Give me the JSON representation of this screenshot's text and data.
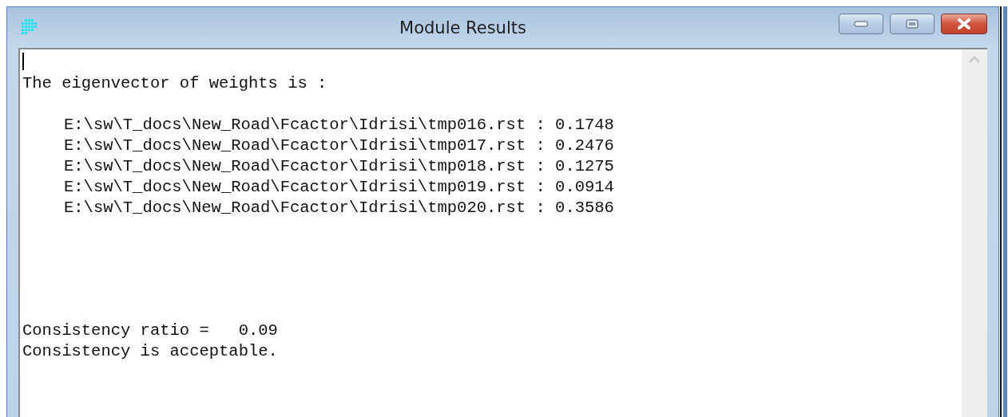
{
  "window": {
    "title": "Module Results"
  },
  "output": {
    "heading": "The eigenvector of weights is :",
    "weights": [
      "E:\\sw\\T_docs\\New_Road\\Fcactor\\Idrisi\\tmp016.rst : 0.1748",
      "E:\\sw\\T_docs\\New_Road\\Fcactor\\Idrisi\\tmp017.rst : 0.2476",
      "E:\\sw\\T_docs\\New_Road\\Fcactor\\Idrisi\\tmp018.rst : 0.1275",
      "E:\\sw\\T_docs\\New_Road\\Fcactor\\Idrisi\\tmp019.rst : 0.0914",
      "E:\\sw\\T_docs\\New_Road\\Fcactor\\Idrisi\\tmp020.rst : 0.3586"
    ],
    "ratio": "Consistency ratio =   0.09",
    "verdict": "Consistency is acceptable."
  }
}
